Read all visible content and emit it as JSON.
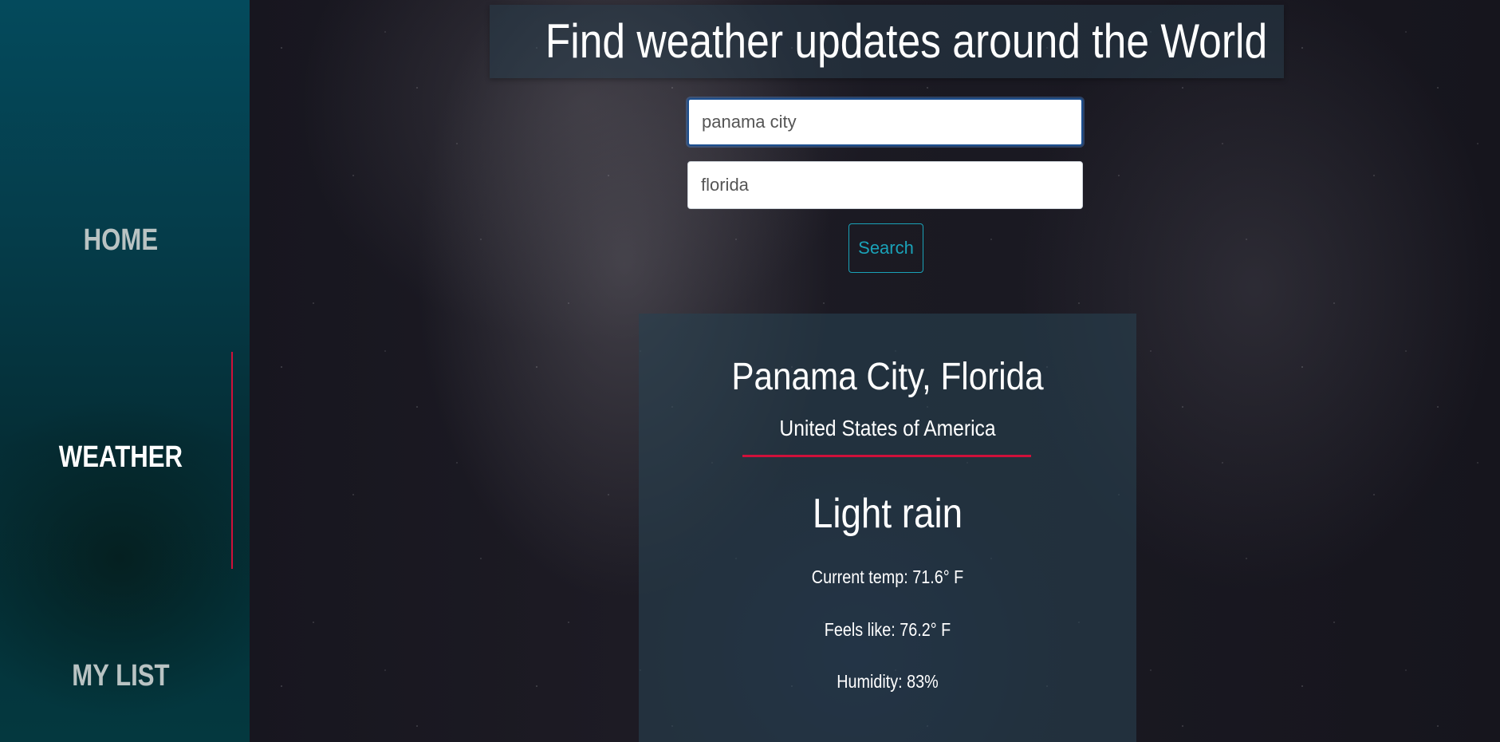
{
  "sidebar": {
    "items": [
      {
        "label": "HOME",
        "active": false
      },
      {
        "label": "WEATHER",
        "active": true
      },
      {
        "label": "MY LIST",
        "active": false
      }
    ]
  },
  "header": {
    "title": "Find weather updates around the World"
  },
  "search": {
    "city_value": "panama city",
    "state_value": "florida",
    "button_label": "Search"
  },
  "weather": {
    "location": "Panama City, Florida",
    "country": "United States of America",
    "condition": "Light rain",
    "current_temp": "Current temp: 71.6° F",
    "feels_like": "Feels like: 76.2° F",
    "humidity": "Humidity: 83%"
  },
  "colors": {
    "accent": "#d0103a",
    "button": "#1aa2b8",
    "sidebar_top": "#044a5c"
  }
}
